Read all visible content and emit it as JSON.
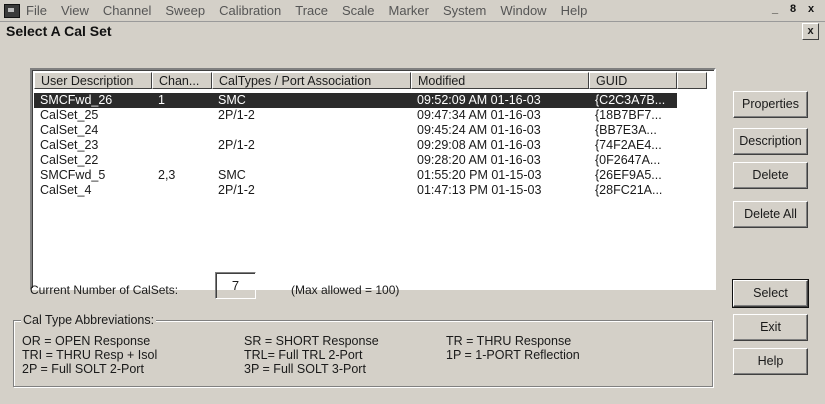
{
  "menubar": {
    "items": [
      "File",
      "View",
      "Channel",
      "Sweep",
      "Calibration",
      "Trace",
      "Scale",
      "Marker",
      "System",
      "Window",
      "Help"
    ],
    "window_controls": [
      "_",
      "8",
      "x"
    ]
  },
  "dialog": {
    "title": "Select A Cal Set",
    "close_label": "x"
  },
  "table": {
    "columns": [
      "User Description",
      "Chan...",
      "CalTypes / Port Association",
      "Modified",
      "GUID"
    ],
    "rows": [
      {
        "desc": "SMCFwd_26",
        "chan": "1",
        "type": "SMC",
        "modified": "09:52:09 AM  01-16-03",
        "guid": "{C2C3A7B..."
      },
      {
        "desc": "CalSet_25",
        "chan": "",
        "type": "2P/1-2",
        "modified": "09:47:34 AM  01-16-03",
        "guid": "{18B7BF7..."
      },
      {
        "desc": "CalSet_24",
        "chan": "",
        "type": "",
        "modified": "09:45:24 AM  01-16-03",
        "guid": "{BB7E3A..."
      },
      {
        "desc": "CalSet_23",
        "chan": "",
        "type": "2P/1-2",
        "modified": "09:29:08 AM  01-16-03",
        "guid": "{74F2AE4..."
      },
      {
        "desc": "CalSet_22",
        "chan": "",
        "type": "",
        "modified": "09:28:20 AM  01-16-03",
        "guid": "{0F2647A..."
      },
      {
        "desc": "SMCFwd_5",
        "chan": "2,3",
        "type": "SMC",
        "modified": "01:55:20 PM  01-15-03",
        "guid": "{26EF9A5..."
      },
      {
        "desc": "CalSet_4",
        "chan": "",
        "type": "2P/1-2",
        "modified": "01:47:13 PM  01-15-03",
        "guid": "{28FC21A..."
      }
    ],
    "selected_index": 0
  },
  "buttons": {
    "properties": "Properties",
    "description": "Description",
    "delete": "Delete",
    "delete_all": "Delete All",
    "select": "Select",
    "exit": "Exit",
    "help": "Help"
  },
  "count": {
    "label": "Current Number of CalSets:",
    "value": "7",
    "max_label": "(Max allowed = 100)"
  },
  "abbreviations": {
    "title": "Cal Type Abbreviations:",
    "col1": [
      "OR  = OPEN Response",
      "TRI = THRU Resp + Isol",
      "2P  = Full SOLT 2-Port"
    ],
    "col2": [
      "SR  = SHORT Response",
      "TRL= Full TRL 2-Port",
      "3P  = Full SOLT 3-Port"
    ],
    "col3": [
      "TR = THRU Response",
      "1P  = 1-PORT Reflection"
    ]
  }
}
